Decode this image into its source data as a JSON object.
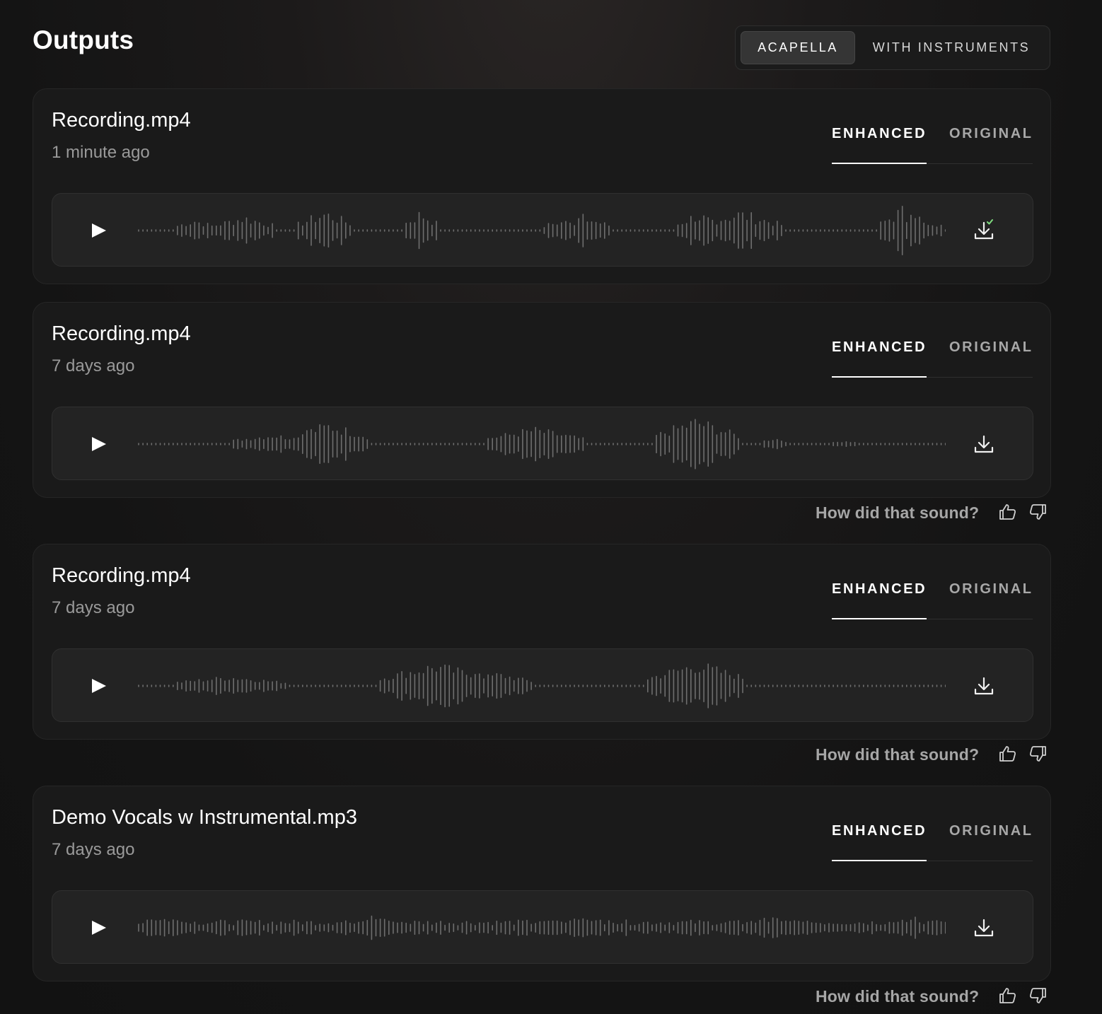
{
  "page_title": "Outputs",
  "mode_toggle": {
    "options": [
      "ACAPELLA",
      "WITH INSTRUMENTS"
    ],
    "selected": "ACAPELLA"
  },
  "tabs": {
    "enhanced_label": "ENHANCED",
    "original_label": "ORIGINAL",
    "selected": "ENHANCED"
  },
  "feedback_prompt": "How did that sound?",
  "colors": {
    "background": "#141414",
    "card": "#1a1a1a",
    "player": "#232323",
    "waveform": "#6e6e6e",
    "download_complete_check": "#7fdc7f"
  },
  "outputs": [
    {
      "file_name": "Recording.mp4",
      "time_ago": "1 minute ago",
      "download_icon": "download-complete-icon",
      "show_feedback": false
    },
    {
      "file_name": "Recording.mp4",
      "time_ago": "7 days ago",
      "download_icon": "download-icon",
      "show_feedback": true
    },
    {
      "file_name": "Recording.mp4",
      "time_ago": "7 days ago",
      "download_icon": "download-icon",
      "show_feedback": true
    },
    {
      "file_name": "Demo Vocals w Instrumental.mp3",
      "time_ago": "7 days ago",
      "download_icon": "download-icon",
      "show_feedback": true
    }
  ]
}
